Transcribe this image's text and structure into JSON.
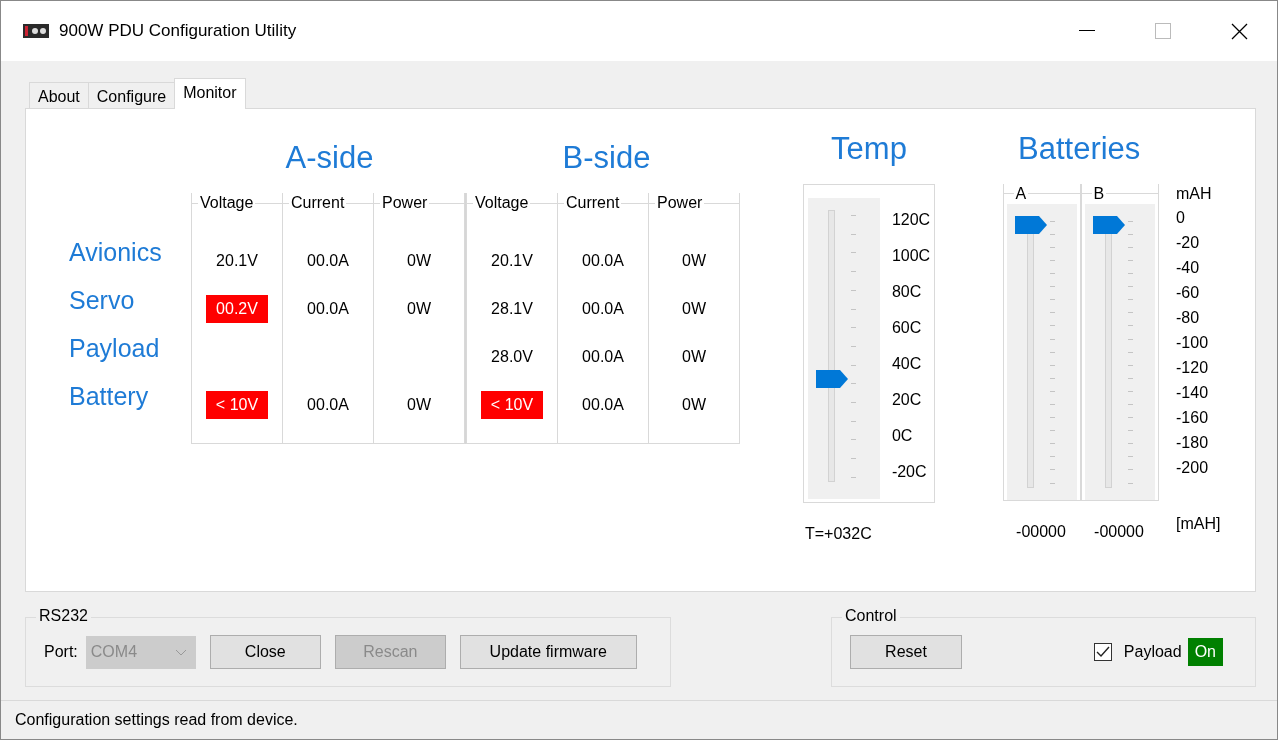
{
  "window": {
    "title": "900W PDU Configuration Utility"
  },
  "tabs": [
    {
      "label": "About",
      "selected": false
    },
    {
      "label": "Configure",
      "selected": false
    },
    {
      "label": "Monitor",
      "selected": true
    }
  ],
  "sides": [
    {
      "title": "A-side",
      "columns": [
        "Voltage",
        "Current",
        "Power"
      ]
    },
    {
      "title": "B-side",
      "columns": [
        "Voltage",
        "Current",
        "Power"
      ]
    }
  ],
  "rows": [
    {
      "label": "Avionics",
      "a": [
        {
          "text": "20.1V",
          "alarm": false
        },
        {
          "text": "00.0A",
          "alarm": false
        },
        {
          "text": "0W",
          "alarm": false
        }
      ],
      "b": [
        {
          "text": "20.1V",
          "alarm": false
        },
        {
          "text": "00.0A",
          "alarm": false
        },
        {
          "text": "0W",
          "alarm": false
        }
      ]
    },
    {
      "label": "Servo",
      "a": [
        {
          "text": "00.2V",
          "alarm": true
        },
        {
          "text": "00.0A",
          "alarm": false
        },
        {
          "text": "0W",
          "alarm": false
        }
      ],
      "b": [
        {
          "text": "28.1V",
          "alarm": false
        },
        {
          "text": "00.0A",
          "alarm": false
        },
        {
          "text": "0W",
          "alarm": false
        }
      ]
    },
    {
      "label": "Payload",
      "b": [
        {
          "text": "28.0V",
          "alarm": false
        },
        {
          "text": "00.0A",
          "alarm": false
        },
        {
          "text": "0W",
          "alarm": false
        }
      ]
    },
    {
      "label": "Battery",
      "a": [
        {
          "text": "< 10V",
          "alarm": true
        },
        {
          "text": "00.0A",
          "alarm": false
        },
        {
          "text": "0W",
          "alarm": false
        }
      ],
      "b": [
        {
          "text": "< 10V",
          "alarm": true
        },
        {
          "text": "00.0A",
          "alarm": false
        },
        {
          "text": "0W",
          "alarm": false
        }
      ]
    }
  ],
  "temp": {
    "title": "Temp",
    "scale": [
      "120C",
      "100C",
      "80C",
      "60C",
      "40C",
      "20C",
      "0C",
      "-20C"
    ],
    "level": 0.371,
    "reading": "T=+032C"
  },
  "batteries": {
    "title": "Batteries",
    "unit": "mAH",
    "scale": [
      "0",
      "-20",
      "-40",
      "-60",
      "-80",
      "-100",
      "-120",
      "-140",
      "-160",
      "-180",
      "-200"
    ],
    "packs": [
      {
        "label": "A",
        "level": 1,
        "reading": "-00000"
      },
      {
        "label": "B",
        "level": 1,
        "reading": "-00000"
      }
    ],
    "reading_unit": "[mAH]"
  },
  "rs232": {
    "title": "RS232",
    "port_label": "Port:",
    "port": {
      "value": "COM4",
      "disabled": true
    },
    "buttons": [
      {
        "label": "Close",
        "disabled": false
      },
      {
        "label": "Rescan",
        "disabled": true
      },
      {
        "label": "Update firmware",
        "disabled": false
      }
    ]
  },
  "control": {
    "title": "Control",
    "buttons": [
      {
        "label": "Reset",
        "disabled": false
      }
    ],
    "payload": {
      "label": "Payload",
      "checked": true,
      "status": "On",
      "on": true
    }
  },
  "status_bar": {
    "text": "Configuration settings read from device."
  }
}
